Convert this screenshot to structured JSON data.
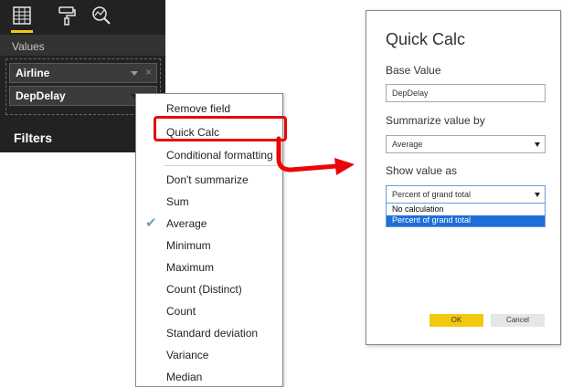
{
  "fields_pane": {
    "tabs": [
      {
        "icon": "fields-grid-icon"
      },
      {
        "icon": "format-paint-roller-icon"
      },
      {
        "icon": "analytics-magnifier-icon"
      }
    ],
    "values_label": "Values",
    "fields": [
      {
        "name": "Airline"
      },
      {
        "name": "DepDelay"
      }
    ],
    "remove_glyph": "×",
    "filters_label": "Filters"
  },
  "context_menu": {
    "items": [
      {
        "label": "Remove field",
        "checked": false
      },
      {
        "label": "Quick Calc",
        "checked": false
      },
      {
        "label": "Conditional formatting",
        "checked": false
      },
      {
        "label": "Don't summarize",
        "checked": false
      },
      {
        "label": "Sum",
        "checked": false
      },
      {
        "label": "Average",
        "checked": true
      },
      {
        "label": "Minimum",
        "checked": false
      },
      {
        "label": "Maximum",
        "checked": false
      },
      {
        "label": "Count (Distinct)",
        "checked": false
      },
      {
        "label": "Count",
        "checked": false
      },
      {
        "label": "Standard deviation",
        "checked": false
      },
      {
        "label": "Variance",
        "checked": false
      },
      {
        "label": "Median",
        "checked": false
      }
    ],
    "check_glyph": "✔",
    "highlight_color": "#e8060a"
  },
  "quick_calc_dialog": {
    "title": "Quick Calc",
    "base_value_label": "Base Value",
    "base_value": "DepDelay",
    "summarize_label": "Summarize value by",
    "summarize_value": "Average",
    "show_value_label": "Show value as",
    "show_value_selected": "Percent of grand total",
    "show_value_options": [
      "No calculation",
      "Percent of grand total"
    ],
    "ok_label": "OK",
    "cancel_label": "Cancel",
    "ok_color": "#f2c811"
  }
}
